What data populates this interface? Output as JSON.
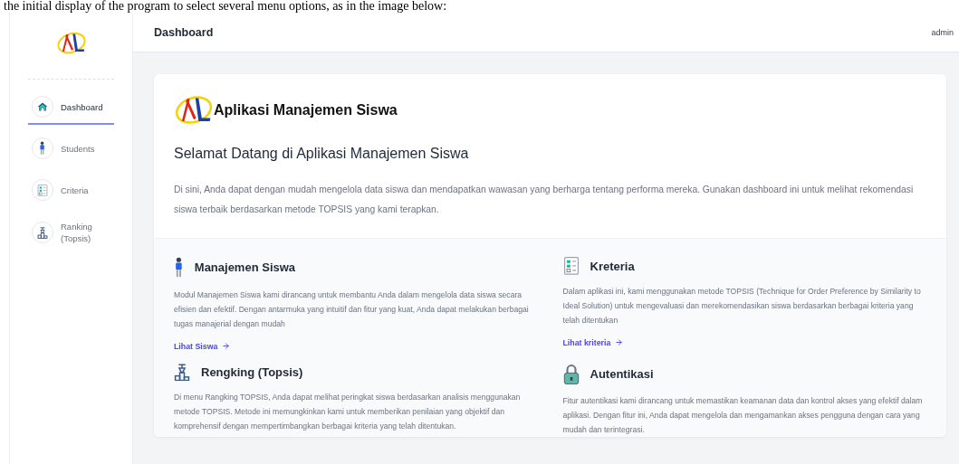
{
  "caption": "the initial display of the program to select several menu options, as in the image below:",
  "sidebar": {
    "items": [
      {
        "kind": "home",
        "label": "Dashboard",
        "selected": true
      },
      {
        "kind": "student",
        "label": "Students",
        "selected": false
      },
      {
        "kind": "criteria",
        "label": "Criteria",
        "selected": false
      },
      {
        "kind": "ranking",
        "label": "Ranking (Topsis)",
        "selected": false
      }
    ]
  },
  "topbar": {
    "title": "Dashboard",
    "user": "admin"
  },
  "hero": {
    "app_name": "Aplikasi Manajemen Siswa",
    "heading": "Selamat Datang di Aplikasi Manajemen Siswa",
    "text": "Di sini, Anda dapat dengan mudah mengelola data siswa dan mendapatkan wawasan yang berharga tentang performa mereka. Gunakan dashboard ini untuk melihat rekomendasi siswa terbaik berdasarkan metode TOPSIS yang kami terapkan."
  },
  "features": [
    {
      "kind": "student",
      "title": "Manajemen Siswa",
      "text": "Modul Manajemen Siswa kami dirancang untuk membantu Anda dalam mengelola data siswa secara efisien dan efektif. Dengan antarmuka yang intuitif dan fitur yang kuat, Anda dapat melakukan berbagai tugas manajerial dengan mudah",
      "link": "Lihat Siswa"
    },
    {
      "kind": "criteria",
      "title": "Kreteria",
      "text": "Dalam aplikasi ini, kami menggunakan metode TOPSIS (Technique for Order Preference by Similarity to Ideal Solution) untuk mengevaluasi dan merekomendasikan siswa berdasarkan berbagai kriteria yang telah ditentukan",
      "link": "Lihat kriteria"
    },
    {
      "kind": "ranking",
      "title": "Rengking (Topsis)",
      "text": "Di menu Rangking TOPSIS, Anda dapat melihat peringkat siswa berdasarkan analisis menggunakan metode TOPSIS. Metode ini memungkinkan kami untuk memberikan penilaian yang objektif dan komprehensif dengan mempertimbangkan berbagai kriteria yang telah ditentukan."
    },
    {
      "kind": "lock",
      "title": "Autentikasi",
      "text": "Fitur autentikasi kami dirancang untuk memastikan keamanan data dan kontrol akses yang efektif dalam aplikasi. Dengan fitur ini, Anda dapat mengelola dan mengamankan akses pengguna dengan cara yang mudah dan terintegrasi."
    }
  ]
}
